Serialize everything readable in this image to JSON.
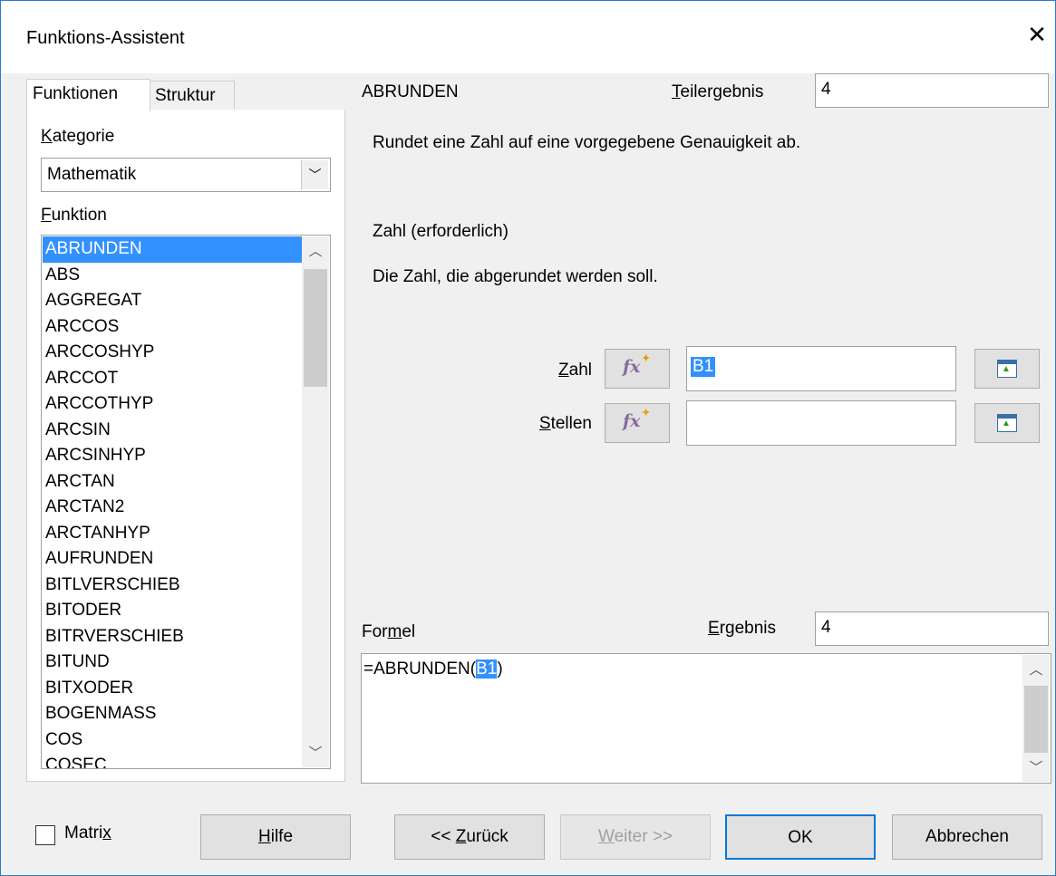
{
  "window": {
    "title": "Funktions-Assistent",
    "close_glyph": "✕"
  },
  "tabs": [
    {
      "label": "Funktionen"
    },
    {
      "label": "Struktur"
    }
  ],
  "category": {
    "label_prefix": "",
    "label_u": "K",
    "label_rest": "ategorie",
    "value": "Mathematik"
  },
  "function_list": {
    "label_u": "F",
    "label_rest": "unktion",
    "selected": "ABRUNDEN",
    "items": [
      "ABRUNDEN",
      "ABS",
      "AGGREGAT",
      "ARCCOS",
      "ARCCOSHYP",
      "ARCCOT",
      "ARCCOTHYP",
      "ARCSIN",
      "ARCSINHYP",
      "ARCTAN",
      "ARCTAN2",
      "ARCTANHYP",
      "AUFRUNDEN",
      "BITLVERSCHIEB",
      "BITODER",
      "BITRVERSCHIEB",
      "BITUND",
      "BITXODER",
      "BOGENMASS",
      "COS",
      "COSEC"
    ]
  },
  "function": {
    "name": "ABRUNDEN",
    "description": "Rundet eine Zahl auf eine vorgegebene Genauigkeit ab.",
    "arg_name": "Zahl (erforderlich)",
    "arg_description": "Die Zahl, die abgerundet werden soll."
  },
  "teilergebnis": {
    "label_u": "T",
    "label_rest": "eilergebnis",
    "value": "4"
  },
  "arguments": [
    {
      "label_u": "Z",
      "label_rest": "ahl",
      "value": "B1"
    },
    {
      "label_u": "S",
      "label_rest": "tellen",
      "value": ""
    }
  ],
  "fx_icon": "fx",
  "formel": {
    "label_a": "For",
    "label_u": "m",
    "label_b": "el",
    "formula_prefix": "=ABRUNDEN(",
    "formula_highlight": "B1",
    "formula_suffix": ")"
  },
  "ergebnis": {
    "label_u": "E",
    "label_rest": "rgebnis",
    "value": "4"
  },
  "footer": {
    "matrix_a": "Matri",
    "matrix_u": "x",
    "help_u": "H",
    "help_rest": "ilfe",
    "back_a": "<< ",
    "back_u": "Z",
    "back_rest": "urück",
    "next_u": "W",
    "next_rest": "eiter >>",
    "ok": "OK",
    "cancel": "Abbrechen"
  }
}
